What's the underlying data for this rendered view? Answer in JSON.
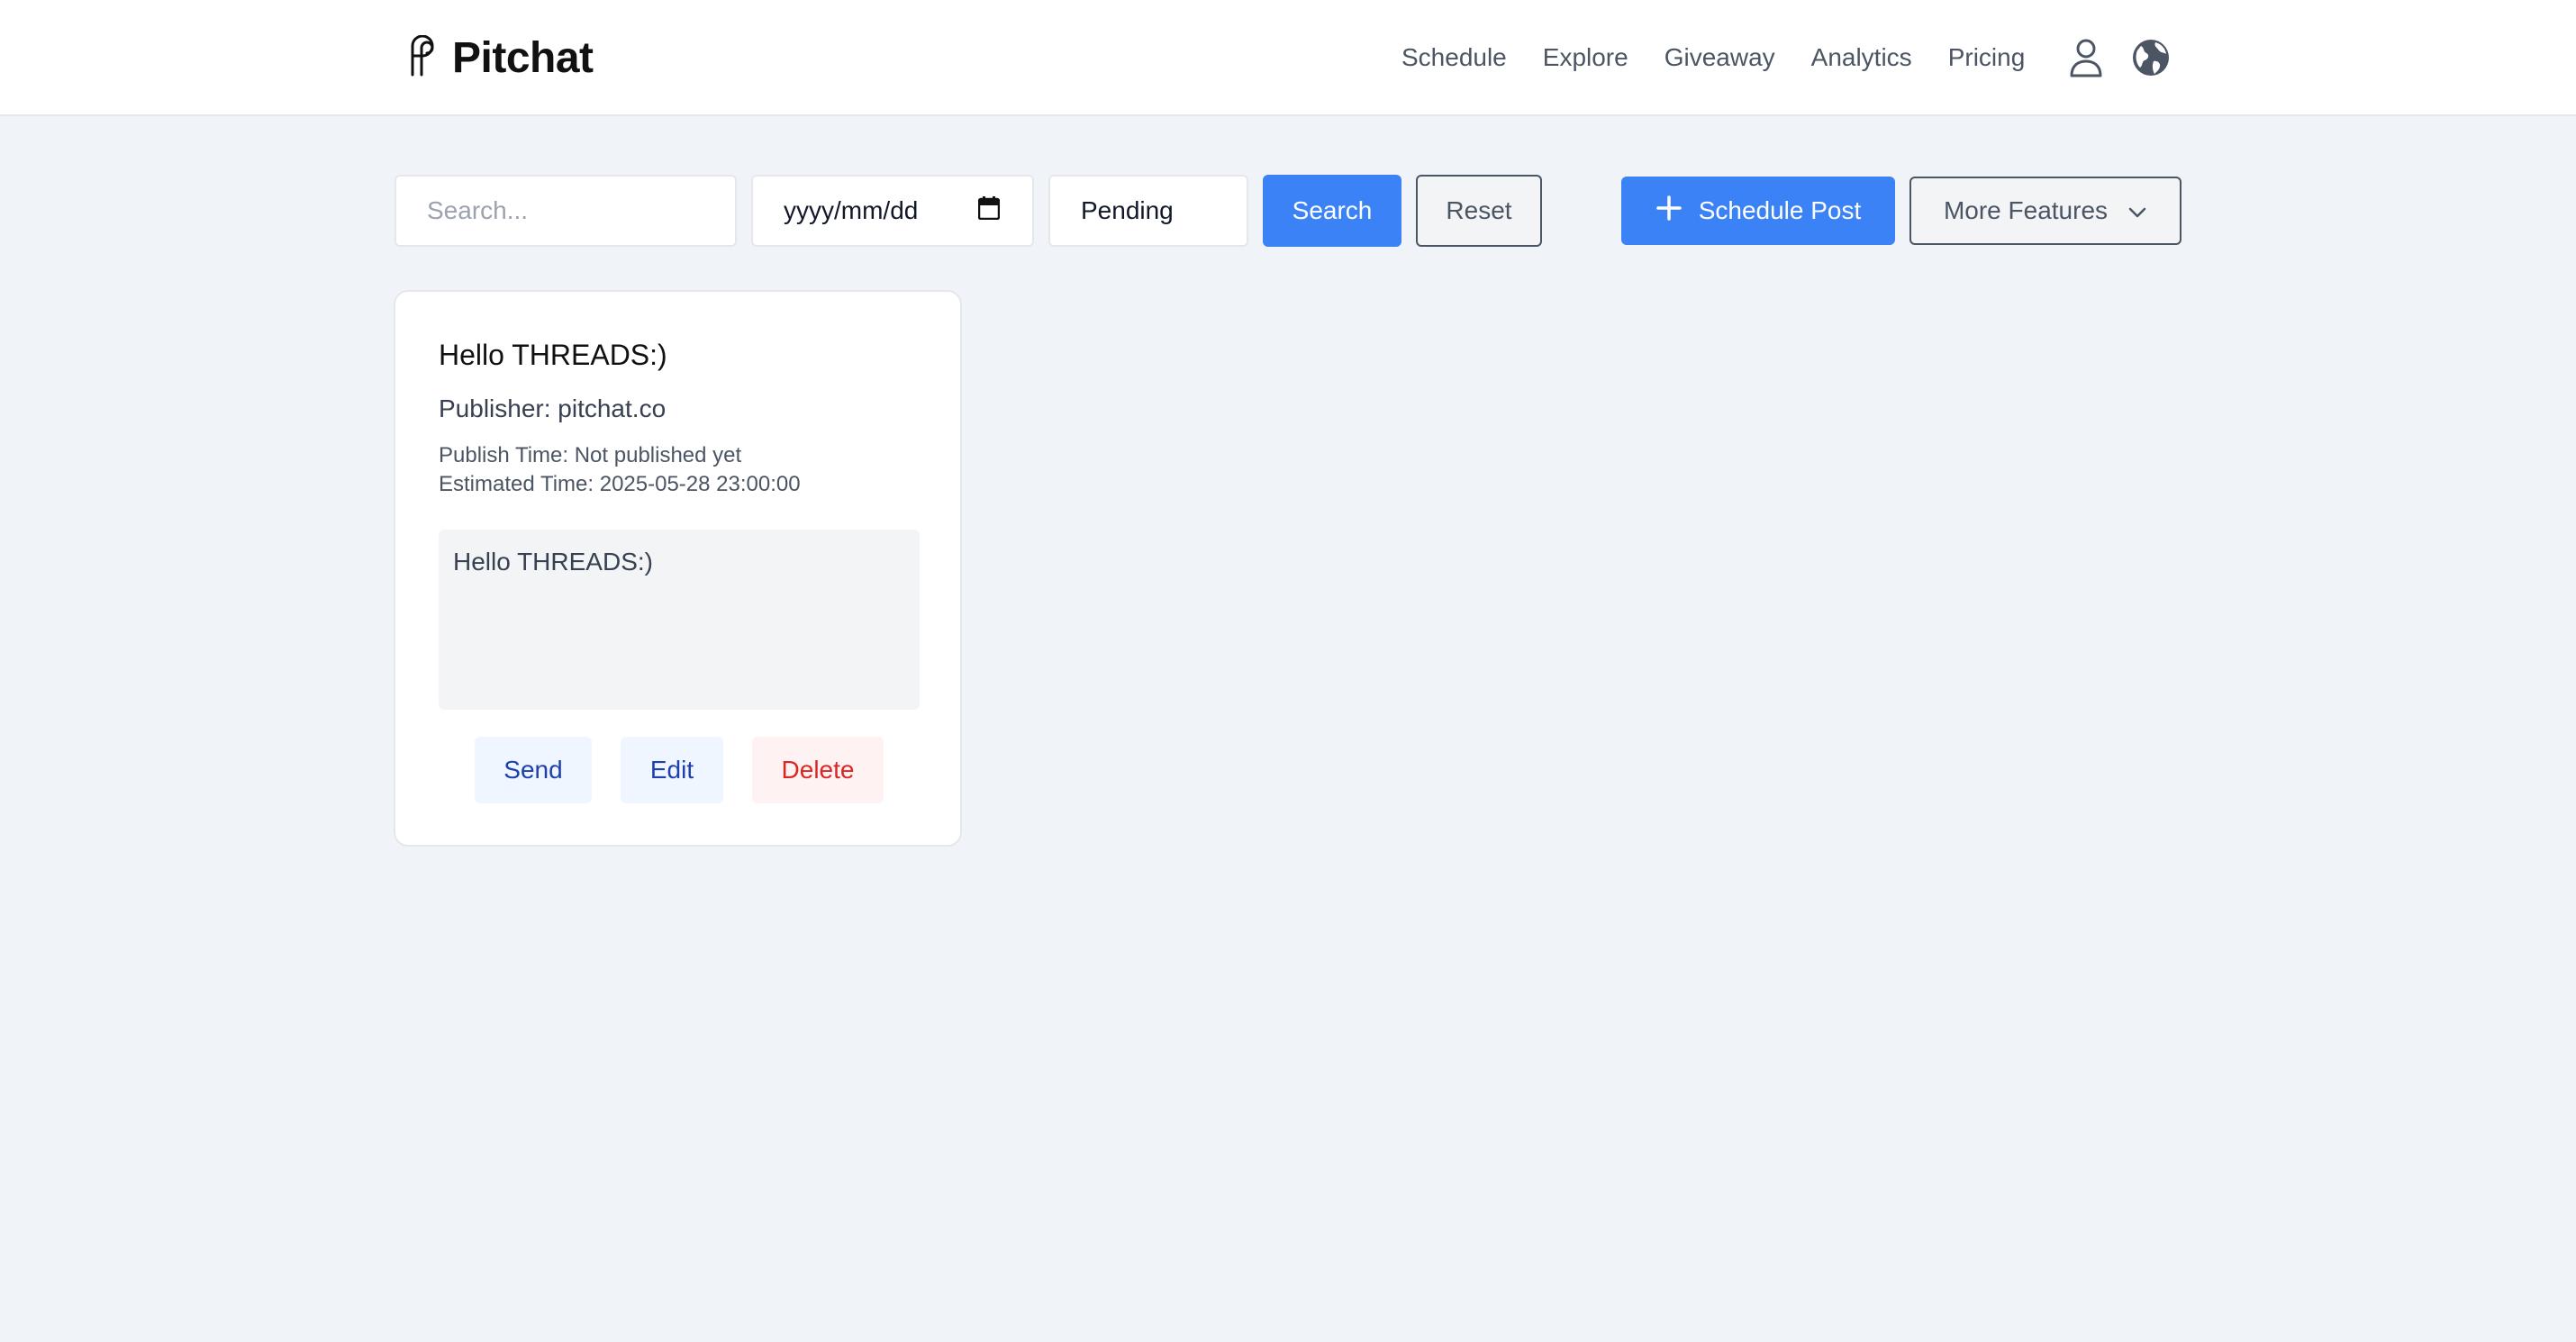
{
  "brand": {
    "name": "Pitchat",
    "logo_icon": "pitchat-logo-icon"
  },
  "nav": {
    "links": [
      "Schedule",
      "Explore",
      "Giveaway",
      "Analytics",
      "Pricing"
    ],
    "icons": [
      "user-icon",
      "globe-icon"
    ]
  },
  "toolbar": {
    "search_placeholder": "Search...",
    "date_value": "yyyy/mm/dd",
    "status_value": "Pending",
    "search_label": "Search",
    "reset_label": "Reset",
    "schedule_label": "Schedule Post",
    "more_label": "More Features"
  },
  "posts": [
    {
      "title": "Hello THREADS:)",
      "publisher": "Publisher: pitchat.co",
      "publish_time": "Publish Time: Not published yet",
      "estimated_time": "Estimated Time: 2025-05-28 23:00:00",
      "content": "Hello THREADS:)",
      "actions": {
        "send": "Send",
        "edit": "Edit",
        "delete": "Delete"
      }
    }
  ],
  "colors": {
    "primary": "#3b82f6",
    "background": "#f0f4f9",
    "delete_text": "#dc2626",
    "action_text": "#1e40af"
  }
}
